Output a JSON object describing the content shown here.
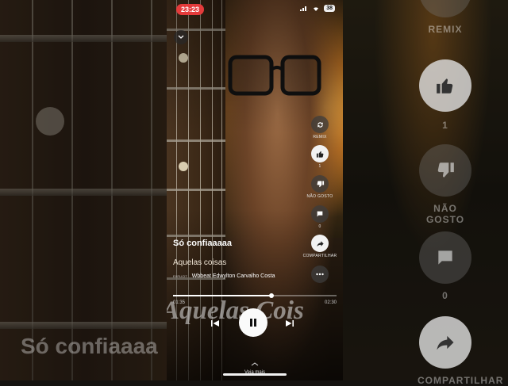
{
  "status_bar": {
    "time": "23:23",
    "battery": "38"
  },
  "track": {
    "title": "Só confiaaaaa",
    "artist": "Aquelas coisas",
    "credits_badge": "EXPLICIT",
    "credits": "Wbbeat Edwylton Carvalho Costa",
    "current_time": "01:35",
    "total_time": "02:30",
    "progress": 0.6
  },
  "artwork_overlay_text": "Aquelas Cois",
  "actions": {
    "remix": "REMIX",
    "likes": "1",
    "dislike": "NÃO GOSTO",
    "comments": "0",
    "share": "COMPARTILHAR"
  },
  "footer": {
    "more": "Veja mais"
  },
  "background": {
    "title": "Só confiaaaa",
    "remix": "REMIX",
    "likes": "1",
    "dislike": "NÃO GOSTO",
    "comments": "0",
    "share": "COMPARTILHAR"
  },
  "colors": {
    "recording_pill": "#e43b3b",
    "accent": "#ffffff"
  }
}
